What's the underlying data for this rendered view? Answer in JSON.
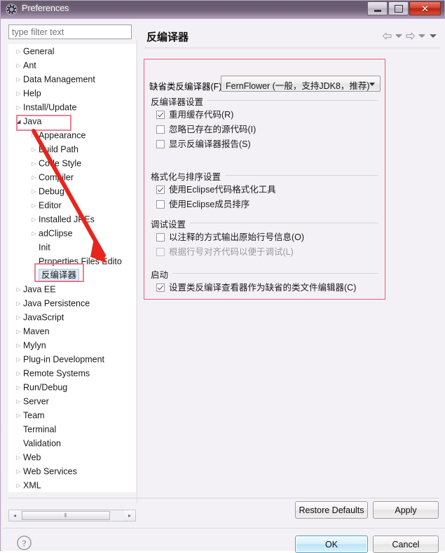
{
  "window": {
    "title": "Preferences",
    "icon": "preferences-gear-icon",
    "controls": {
      "minimize": "minimize",
      "maximize": "maximize",
      "close": "close"
    }
  },
  "filter": {
    "placeholder": "type filter text",
    "value": ""
  },
  "tree": {
    "items": [
      {
        "label": "General",
        "level": 0,
        "twisty": "collapsed",
        "selected": false
      },
      {
        "label": "Ant",
        "level": 0,
        "twisty": "collapsed",
        "selected": false
      },
      {
        "label": "Data Management",
        "level": 0,
        "twisty": "collapsed",
        "selected": false
      },
      {
        "label": "Help",
        "level": 0,
        "twisty": "collapsed",
        "selected": false
      },
      {
        "label": "Install/Update",
        "level": 0,
        "twisty": "collapsed",
        "selected": false
      },
      {
        "label": "Java",
        "level": 0,
        "twisty": "expanded",
        "selected": false
      },
      {
        "label": "Appearance",
        "level": 1,
        "twisty": "collapsed",
        "selected": false
      },
      {
        "label": "Build Path",
        "level": 1,
        "twisty": "collapsed",
        "selected": false
      },
      {
        "label": "Code Style",
        "level": 1,
        "twisty": "collapsed",
        "selected": false
      },
      {
        "label": "Compiler",
        "level": 1,
        "twisty": "collapsed",
        "selected": false
      },
      {
        "label": "Debug",
        "level": 1,
        "twisty": "collapsed",
        "selected": false
      },
      {
        "label": "Editor",
        "level": 1,
        "twisty": "collapsed",
        "selected": false
      },
      {
        "label": "Installed JREs",
        "level": 1,
        "twisty": "collapsed",
        "selected": false
      },
      {
        "label": "adClipse",
        "level": 1,
        "twisty": "collapsed",
        "selected": false
      },
      {
        "label": "Init",
        "level": 1,
        "twisty": "none",
        "selected": false
      },
      {
        "label": "Properties Files Edito",
        "level": 1,
        "twisty": "none",
        "selected": false
      },
      {
        "label": "反编译器",
        "level": 1,
        "twisty": "none",
        "selected": true
      },
      {
        "label": "Java EE",
        "level": 0,
        "twisty": "collapsed",
        "selected": false
      },
      {
        "label": "Java Persistence",
        "level": 0,
        "twisty": "collapsed",
        "selected": false
      },
      {
        "label": "JavaScript",
        "level": 0,
        "twisty": "collapsed",
        "selected": false
      },
      {
        "label": "Maven",
        "level": 0,
        "twisty": "collapsed",
        "selected": false
      },
      {
        "label": "Mylyn",
        "level": 0,
        "twisty": "collapsed",
        "selected": false
      },
      {
        "label": "Plug-in Development",
        "level": 0,
        "twisty": "collapsed",
        "selected": false
      },
      {
        "label": "Remote Systems",
        "level": 0,
        "twisty": "collapsed",
        "selected": false
      },
      {
        "label": "Run/Debug",
        "level": 0,
        "twisty": "collapsed",
        "selected": false
      },
      {
        "label": "Server",
        "level": 0,
        "twisty": "collapsed",
        "selected": false
      },
      {
        "label": "Team",
        "level": 0,
        "twisty": "collapsed",
        "selected": false
      },
      {
        "label": "Terminal",
        "level": 0,
        "twisty": "none",
        "selected": false
      },
      {
        "label": "Validation",
        "level": 0,
        "twisty": "none",
        "selected": false
      },
      {
        "label": "Web",
        "level": 0,
        "twisty": "collapsed",
        "selected": false
      },
      {
        "label": "Web Services",
        "level": 0,
        "twisty": "collapsed",
        "selected": false
      },
      {
        "label": "XML",
        "level": 0,
        "twisty": "collapsed",
        "selected": false
      }
    ],
    "scrollbar": {
      "left_arrow": "◂",
      "right_arrow": "▸",
      "grip": "‖‖"
    }
  },
  "page": {
    "title": "反编译器",
    "nav": {
      "back_icon": "back-arrow-icon",
      "back_menu_icon": "chevron-down-icon",
      "forward_icon": "forward-arrow-icon",
      "forward_menu_icon": "chevron-down-icon",
      "view_menu_icon": "chevron-down-icon"
    },
    "decompiler_label": "缺省类反编译器(F)",
    "decompiler_value": "FernFlower (一般，支持JDK8，推荐)",
    "decompiler_options": [
      "FernFlower (一般，支持JDK8，推荐)"
    ],
    "groups": [
      {
        "title": "反编译器设置",
        "options": [
          {
            "label": "重用缓存代码(R)",
            "checked": true,
            "enabled": true
          },
          {
            "label": "忽略已存在的源代码(I)",
            "checked": false,
            "enabled": true
          },
          {
            "label": "显示反编译器报告(S)",
            "checked": false,
            "enabled": true
          }
        ]
      },
      {
        "title": "格式化与排序设置",
        "options": [
          {
            "label": "使用Eclipse代码格式化工具",
            "checked": true,
            "enabled": true
          },
          {
            "label": "使用Eclipse成员排序",
            "checked": false,
            "enabled": true
          }
        ]
      },
      {
        "title": "调试设置",
        "options": [
          {
            "label": "以注释的方式输出原始行号信息(O)",
            "checked": false,
            "enabled": true
          },
          {
            "label": "根据行号对齐代码以便于调试(L)",
            "checked": false,
            "enabled": false
          }
        ]
      },
      {
        "title": "启动",
        "options": [
          {
            "label": "设置类反编译查看器作为缺省的类文件编辑器(C)",
            "checked": true,
            "enabled": true
          }
        ]
      }
    ]
  },
  "buttons": {
    "restore_defaults": "Restore Defaults",
    "apply": "Apply",
    "ok": "OK",
    "cancel": "Cancel",
    "help_icon": "help-question-icon"
  },
  "annotations": {
    "highlight_color": "#e8607a",
    "arrow_color": "#e8251c",
    "boxes": [
      "java-tree-item",
      "decompiler-tree-item",
      "settings-panel"
    ],
    "arrow": "java-to-decompiler"
  }
}
